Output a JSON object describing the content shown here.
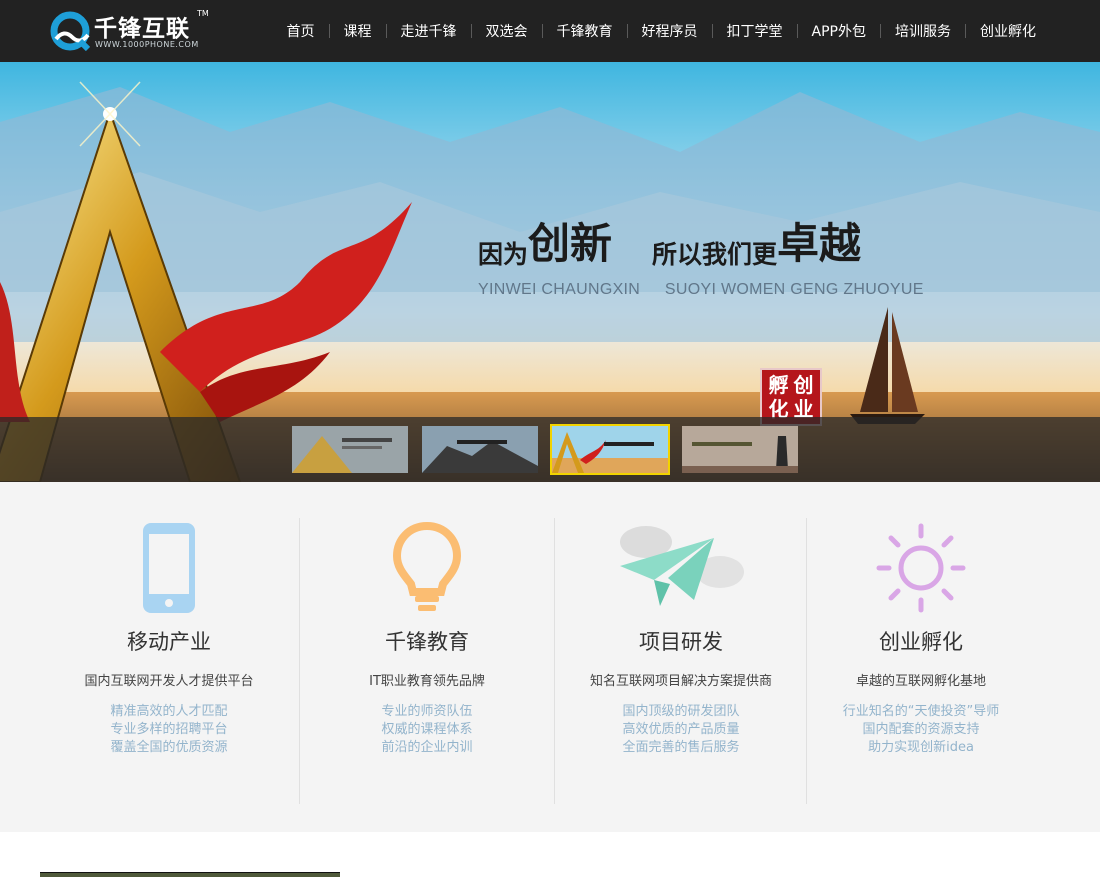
{
  "header": {
    "logo_text": "千锋互联",
    "logo_sub": "WWW.1000PHONE.COM",
    "logo_tm": "TM",
    "nav": [
      "首页",
      "课程",
      "走进千锋",
      "双选会",
      "千锋教育",
      "好程序员",
      "扣丁学堂",
      "APP外包",
      "培训服务",
      "创业孵化"
    ]
  },
  "banner": {
    "slogan_cn_small_1": "因为",
    "slogan_cn_big_1": "创新",
    "slogan_cn_small_2": "所以我们更",
    "slogan_cn_big_2": "卓越",
    "slogan_en_1": "YINWEI CHAUNGXIN",
    "slogan_en_2": "SUOYI WOMEN GENG ZHUOYUE",
    "seal": [
      "孵",
      "创",
      "化",
      "业"
    ],
    "thumbnails_active_index": 2
  },
  "features": [
    {
      "icon": "phone-icon",
      "title": "移动产业",
      "subtitle": "国内互联网开发人才提供平台",
      "points": [
        "精准高效的人才匹配",
        "专业多样的招聘平台",
        "覆盖全国的优质资源"
      ]
    },
    {
      "icon": "lightbulb-icon",
      "title": "千锋教育",
      "subtitle": "IT职业教育领先品牌",
      "points": [
        "专业的师资队伍",
        "权威的课程体系",
        "前沿的企业内训"
      ]
    },
    {
      "icon": "paper-plane-icon",
      "title": "项目研发",
      "subtitle": "知名互联网项目解决方案提供商",
      "points": [
        "国内顶级的研发团队",
        "高效优质的产品质量",
        "全面完善的售后服务"
      ]
    },
    {
      "icon": "sun-icon",
      "title": "创业孵化",
      "subtitle": "卓越的互联网孵化基地",
      "points": [
        "行业知名的“天使投资”导师",
        "国内配套的资源支持",
        "助力实现创新idea"
      ]
    }
  ],
  "colors": {
    "header_bg": "#222222",
    "features_bg": "#f4f4f4",
    "point_text": "#93b4cc",
    "thumb_active_border": "#f2d300"
  }
}
